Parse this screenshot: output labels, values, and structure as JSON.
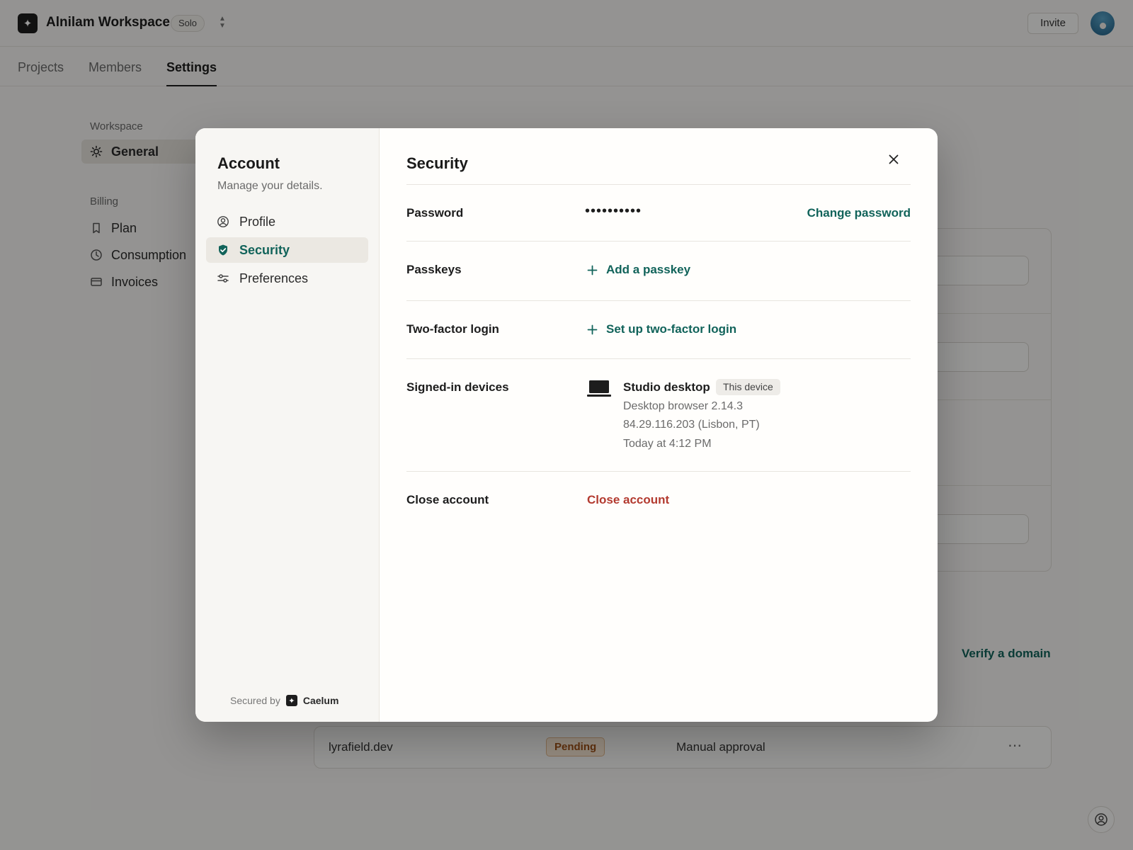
{
  "app": {
    "workspace_name": "Alnilam Workspace",
    "plan_badge": "Solo",
    "invite_label": "Invite"
  },
  "tabs": [
    {
      "label": "Projects",
      "active": false
    },
    {
      "label": "Members",
      "active": false
    },
    {
      "label": "Settings",
      "active": true
    }
  ],
  "sidebar": {
    "sections": [
      {
        "label": "Workspace",
        "items": [
          {
            "label": "General",
            "icon": "gear-icon",
            "active": true
          }
        ]
      },
      {
        "label": "Billing",
        "items": [
          {
            "label": "Plan",
            "icon": "bookmark-icon",
            "active": false
          },
          {
            "label": "Consumption",
            "icon": "clock-icon",
            "active": false
          },
          {
            "label": "Invoices",
            "icon": "card-icon",
            "active": false
          }
        ]
      }
    ]
  },
  "background": {
    "verify_link": "Verify a domain",
    "domain_row": {
      "domain": "lyrafield.dev",
      "status": "Pending",
      "approval": "Manual approval",
      "menu": "⋯"
    }
  },
  "modal": {
    "account_title": "Account",
    "account_subtitle": "Manage your details.",
    "nav": [
      {
        "label": "Profile",
        "icon": "user-circle-icon",
        "active": false
      },
      {
        "label": "Security",
        "icon": "shield-check-icon",
        "active": true
      },
      {
        "label": "Preferences",
        "icon": "sliders-icon",
        "active": false
      }
    ],
    "secured_by_label": "Secured by",
    "secured_by_brand": "Caelum",
    "section_title": "Security",
    "rows": {
      "password": {
        "label": "Password",
        "masked_value": "••••••••••",
        "action": "Change password"
      },
      "passkeys": {
        "label": "Passkeys",
        "action": "Add a passkey"
      },
      "two_factor": {
        "label": "Two-factor login",
        "action": "Set up two-factor login"
      },
      "devices": {
        "label": "Signed-in devices",
        "device_name": "Studio desktop",
        "device_badge": "This device",
        "client": "Desktop browser 2.14.3",
        "ip_location": "84.29.116.203 (Lisbon, PT)",
        "last_seen": "Today at 4:12 PM"
      },
      "close_account": {
        "label": "Close account",
        "action": "Close account"
      }
    }
  },
  "colors": {
    "accent": "#11635a",
    "danger": "#b33a2f",
    "pending_text": "#a15217",
    "pending_bg": "#fbe9d6"
  }
}
